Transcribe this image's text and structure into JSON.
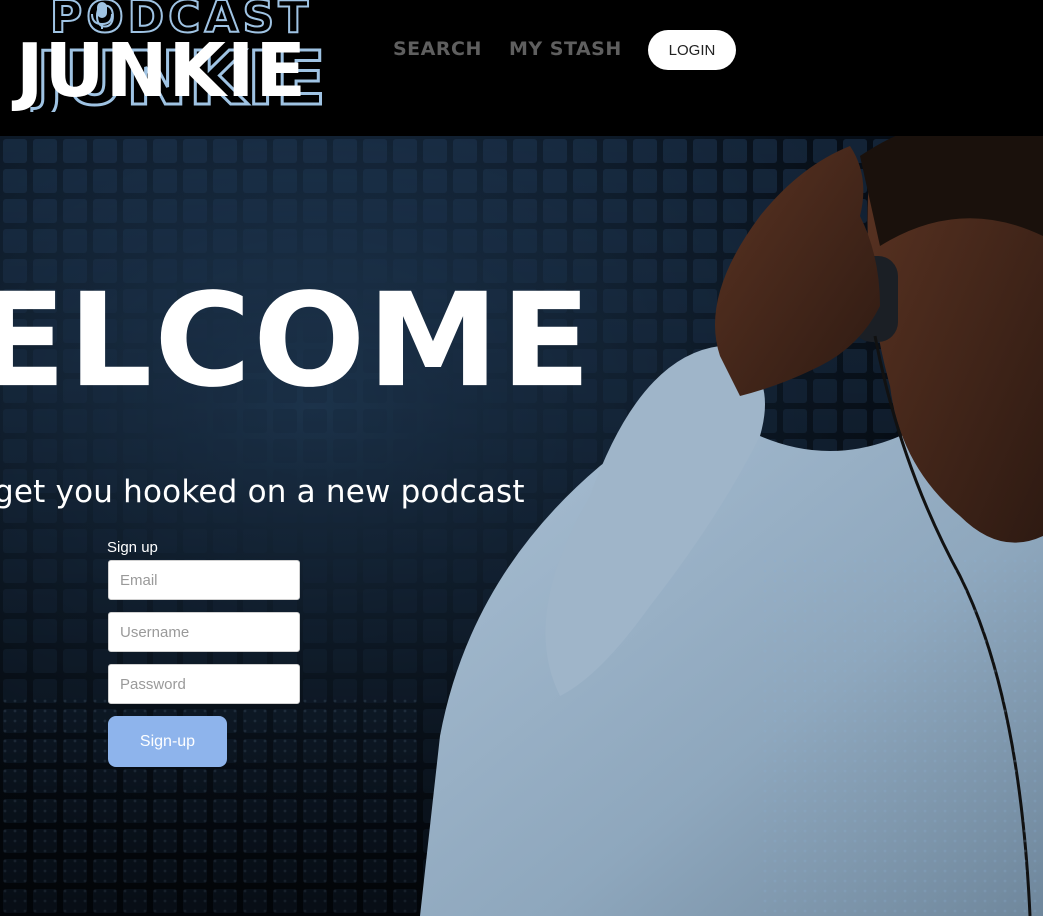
{
  "header": {
    "logo": {
      "top_text": "PODCAST",
      "bottom_text": "JUNKIE"
    },
    "nav": [
      {
        "label": "SEARCH"
      },
      {
        "label": "MY STASH"
      }
    ],
    "login_label": "LOGIN"
  },
  "hero": {
    "welcome_text": "ELCOME",
    "tagline": "get you hooked on a new podcast",
    "signup": {
      "heading": "Sign up",
      "email_placeholder": "Email",
      "username_placeholder": "Username",
      "password_placeholder": "Password",
      "button_label": "Sign-up"
    },
    "background_image": "man-with-headphones-photo"
  },
  "colors": {
    "header_bg": "#000000",
    "nav_text": "#5f5f5f",
    "logo_blue": "#9fc3e3",
    "signup_button": "#8eb4ec"
  }
}
